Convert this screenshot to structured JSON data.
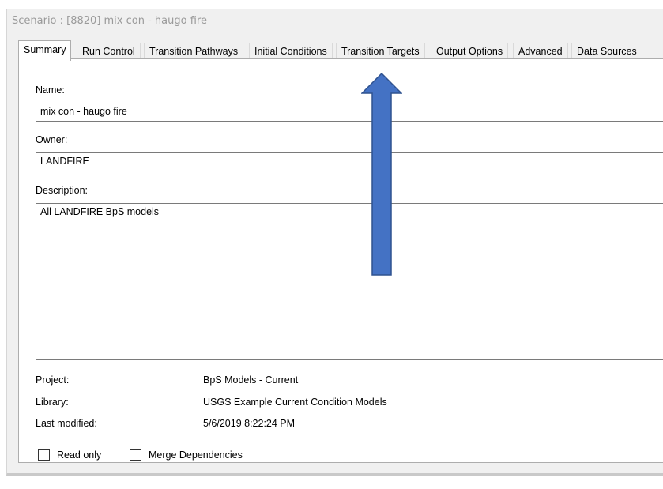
{
  "window": {
    "title": "Scenario : [8820] mix con - haugo fire"
  },
  "tabs": [
    {
      "label": "Summary",
      "active": true
    },
    {
      "label": "Run Control",
      "active": false
    },
    {
      "label": "Transition Pathways",
      "active": false
    },
    {
      "label": "Initial Conditions",
      "active": false
    },
    {
      "label": "Transition Targets",
      "active": false
    },
    {
      "label": "Output Options",
      "active": false
    },
    {
      "label": "Advanced",
      "active": false
    },
    {
      "label": "Data Sources",
      "active": false
    }
  ],
  "summary": {
    "name_label": "Name:",
    "name_value": "mix con - haugo fire",
    "owner_label": "Owner:",
    "owner_value": "LANDFIRE",
    "description_label": "Description:",
    "description_value": "All LANDFIRE BpS models",
    "project_label": "Project:",
    "project_value": "BpS Models - Current",
    "library_label": "Library:",
    "library_value": "USGS Example Current Condition Models",
    "last_modified_label": "Last modified:",
    "last_modified_value": "5/6/2019 8:22:24 PM",
    "read_only_label": "Read only",
    "read_only_checked": false,
    "merge_dependencies_label": "Merge Dependencies",
    "merge_dependencies_checked": false
  },
  "annotation": {
    "arrow_color": "#4472c4",
    "arrow_outline": "#2f528f",
    "arrow_direction": "up"
  }
}
